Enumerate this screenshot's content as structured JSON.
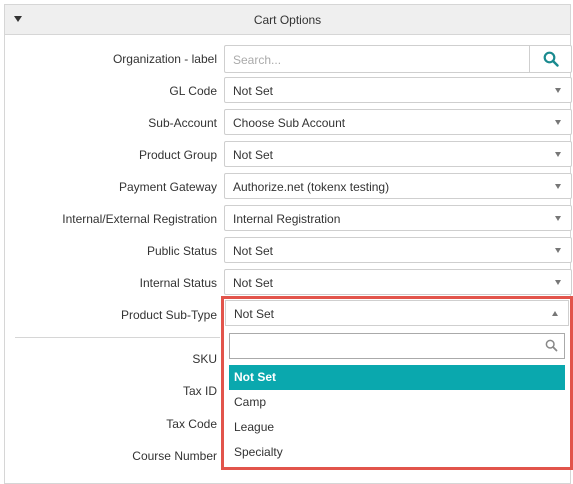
{
  "panel": {
    "title": "Cart Options"
  },
  "fields": {
    "organization": {
      "label": "Organization - label",
      "placeholder": "Search..."
    },
    "gl_code": {
      "label": "GL Code",
      "value": "Not Set"
    },
    "sub_account": {
      "label": "Sub-Account",
      "value": "Choose Sub Account"
    },
    "product_group": {
      "label": "Product Group",
      "value": "Not Set"
    },
    "payment_gateway": {
      "label": "Payment Gateway",
      "value": "Authorize.net (tokenx testing)"
    },
    "registration": {
      "label": "Internal/External Registration",
      "value": "Internal Registration"
    },
    "public_status": {
      "label": "Public Status",
      "value": "Not Set"
    },
    "internal_status": {
      "label": "Internal Status",
      "value": "Not Set"
    },
    "product_sub_type": {
      "label": "Product Sub-Type",
      "value": "Not Set"
    },
    "sku": {
      "label": "SKU"
    },
    "tax_id": {
      "label": "Tax ID"
    },
    "tax_code": {
      "label": "Tax Code"
    },
    "course_number": {
      "label": "Course Number"
    }
  },
  "dropdown": {
    "search_value": "",
    "options": [
      "Not Set",
      "Camp",
      "League",
      "Specialty"
    ],
    "selected": "Not Set"
  },
  "colors": {
    "accent": "#0aa8ae",
    "highlight_border": "#e2544b",
    "search_icon": "#1a8a8f"
  }
}
